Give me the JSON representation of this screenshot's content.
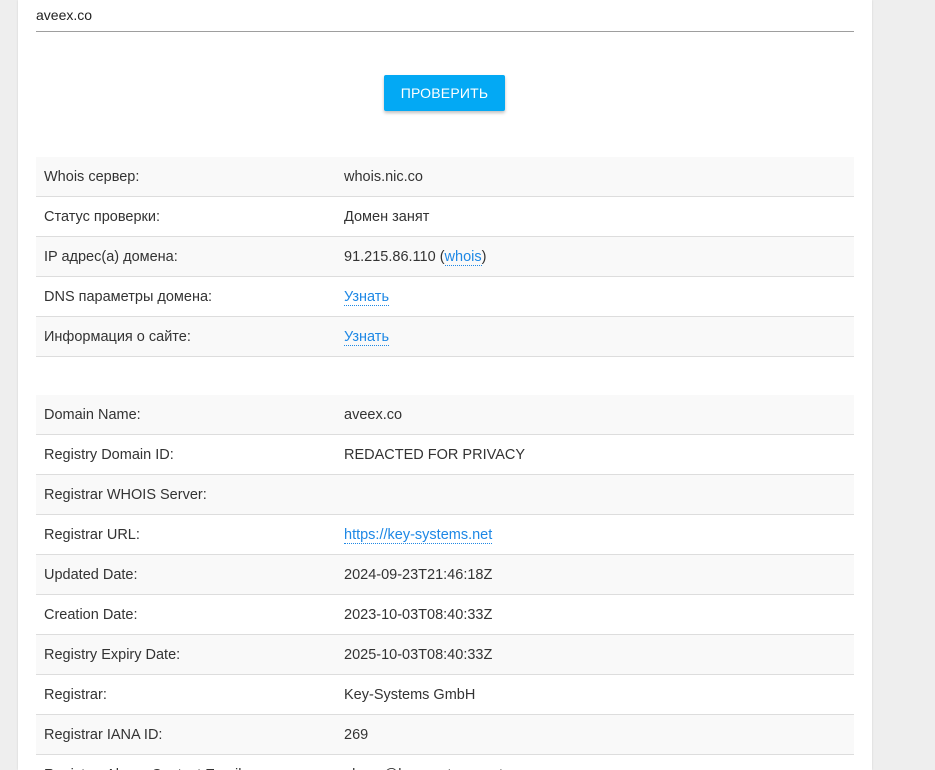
{
  "search": {
    "value": "aveex.co"
  },
  "check_button": {
    "label": "ПРОВЕРИТЬ"
  },
  "status_rows": [
    {
      "label": "Whois сервер:",
      "value": "whois.nic.co"
    },
    {
      "label": "Статус проверки:",
      "value": "Домен занят"
    },
    {
      "label": "IP адрес(а) домена:",
      "value": "91.215.86.110",
      "paren_open": "(",
      "link": "whois",
      "paren_close": ")"
    },
    {
      "label": "DNS параметры домена:",
      "link": "Узнать"
    },
    {
      "label": "Информация о сайте:",
      "link": "Узнать"
    }
  ],
  "whois_rows": [
    {
      "label": "Domain Name:",
      "value": "aveex.co"
    },
    {
      "label": "Registry Domain ID:",
      "value": "REDACTED FOR PRIVACY"
    },
    {
      "label": "Registrar WHOIS Server:",
      "value": ""
    },
    {
      "label": "Registrar URL:",
      "link": "https://key-systems.net"
    },
    {
      "label": "Updated Date:",
      "value": "2024-09-23T21:46:18Z"
    },
    {
      "label": "Creation Date:",
      "value": "2023-10-03T08:40:33Z"
    },
    {
      "label": "Registry Expiry Date:",
      "value": "2025-10-03T08:40:33Z"
    },
    {
      "label": "Registrar:",
      "value": "Key-Systems GmbH"
    },
    {
      "label": "Registrar IANA ID:",
      "value": "269"
    },
    {
      "label": "Registrar Abuse Contact Email:",
      "value": "abuse@key-systems.net"
    }
  ]
}
